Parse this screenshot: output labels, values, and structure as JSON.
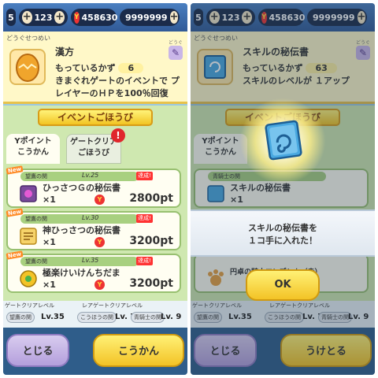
{
  "colors": {
    "accent_yellow": "#f3c326",
    "topbar_blue": "#315a97",
    "reward_green": "#cfe8b0",
    "alert_red": "#e0262c"
  },
  "left": {
    "topbar": {
      "stamina": "5",
      "add_label": "123",
      "coin_icon": "yokai-coin-icon",
      "money": "458630",
      "gem_icon": "gem-icon",
      "gems": "9999999"
    },
    "info": {
      "category": "どうぐせつめい",
      "category_right": "どうぐ",
      "title": "漢方",
      "owned_label": "もっているかず",
      "owned_count": "6",
      "description": "きまぐれゲートのイベントで プレイヤーのＨＰを100％回復"
    },
    "reward": {
      "ribbon": "イベントごほうび",
      "tab_y_line1": "Yポイント",
      "tab_y_line2": "こうかん",
      "tab_gate_line1": "ゲートクリア",
      "tab_gate_line2": "ごほうび",
      "tab_alert": "!",
      "rows": [
        {
          "new": "New",
          "gate": "望鷹の関",
          "lv": "Lv.25",
          "status": "達成!",
          "name": "ひっさつＧの秘伝書",
          "qty": "×1",
          "price": "2800pt"
        },
        {
          "new": "New",
          "gate": "望鷹の関",
          "lv": "Lv.30",
          "status": "達成!",
          "name": "神ひっさつの秘伝書",
          "qty": "×1",
          "price": "3200pt"
        },
        {
          "new": "New",
          "gate": "望鷹の関",
          "lv": "Lv.35",
          "status": "達成!",
          "name": "極楽けいけんちだま",
          "qty": "×1",
          "price": "3200pt"
        }
      ]
    },
    "clearbar": {
      "label_gate": "ゲートクリアレベル",
      "label_rare": "レアゲートクリアレベル",
      "chip1": "望鷹の関",
      "lv1": "Lv.35",
      "chip2": "こうほうの関",
      "lv2": "Lv. 7",
      "chip3": "青騎士の関",
      "lv3": "Lv. 9"
    },
    "buttons": {
      "close": "とじる",
      "exchange": "こうかん"
    }
  },
  "right": {
    "topbar": {
      "stamina": "5",
      "add_label": "123",
      "coin_icon": "yokai-coin-icon",
      "money": "458630",
      "gem_icon": "gem-icon",
      "gems": "9999999"
    },
    "info": {
      "category": "どうぐせつめい",
      "category_right": "どうぐ",
      "title": "スキルの秘伝書",
      "owned_label": "もっているかず",
      "owned_count": "63",
      "description": "スキルのレベルが １アップ"
    },
    "reward": {
      "ribbon": "イベントごほうび",
      "tab_y_line1": "Yポイント",
      "tab_y_line2": "こうかん",
      "row1_gate": "青騎士の関",
      "row1_name": "スキルの秘伝書",
      "row1_qty": "×1",
      "row2_name": "円卓の騎士エンブレム（赤）"
    },
    "dialog": {
      "line1": "スキルの秘伝書を",
      "line2": "１コ手に入れた！",
      "ok": "OK"
    },
    "clearbar": {
      "label_gate": "ゲートクリアレベル",
      "label_rare": "レアゲートクリアレベル",
      "chip1": "望鷹の関",
      "lv1": "Lv.35",
      "chip2": "こうほうの関",
      "lv2": "Lv. 7",
      "chip3": "青騎士の関",
      "lv3": "Lv. 9"
    },
    "buttons": {
      "close": "とじる",
      "receive": "うけとる"
    }
  }
}
